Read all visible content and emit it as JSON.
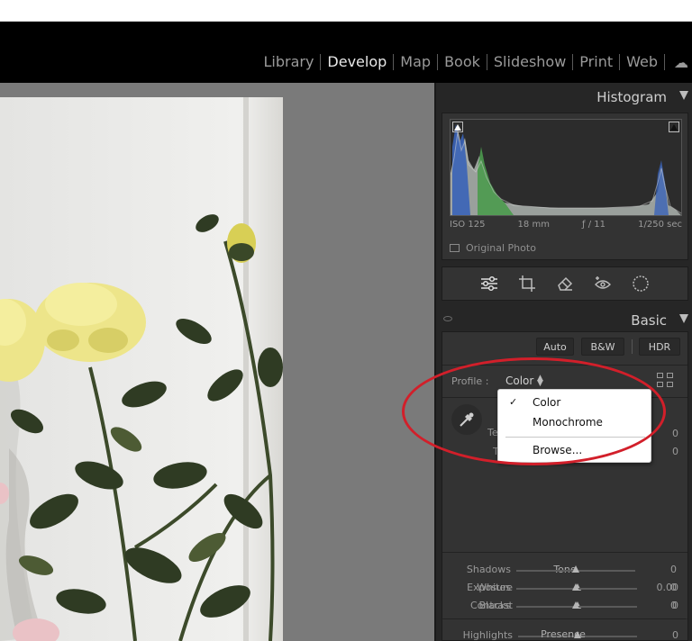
{
  "modules": [
    {
      "label": "Library",
      "active": false
    },
    {
      "label": "Develop",
      "active": true
    },
    {
      "label": "Map",
      "active": false
    },
    {
      "label": "Book",
      "active": false
    },
    {
      "label": "Slideshow",
      "active": false
    },
    {
      "label": "Print",
      "active": false
    },
    {
      "label": "Web",
      "active": false
    }
  ],
  "histogram": {
    "title": "Histogram",
    "iso": "ISO 125",
    "focal": "18 mm",
    "aperture": "ƒ / 11",
    "shutter": "1/250 sec",
    "original_photo_label": "Original Photo",
    "original_photo_checked": false
  },
  "tools": [
    "sliders-icon",
    "crop-icon",
    "eraser-icon",
    "redeye-icon",
    "mask-icon"
  ],
  "basic": {
    "title": "Basic",
    "auto_label": "Auto",
    "bw_label": "B&W",
    "hdr_label": "HDR",
    "profile_label": "Profile :",
    "profile_value": "Color",
    "wb_partial_labels": [
      "Ter",
      "T"
    ],
    "wb_values": [
      "0",
      "0"
    ],
    "tone_title": "Tone",
    "presence_title": "Presence",
    "sliders": [
      {
        "label": "Exposure",
        "value": "0.00",
        "position": 0.5
      },
      {
        "label": "Contrast",
        "value": "0",
        "position": 0.5
      },
      {
        "label": "Highlights",
        "value": "0",
        "position": 0.5
      },
      {
        "label": "Shadows",
        "value": "0",
        "position": 0.5
      },
      {
        "label": "Whites",
        "value": "0",
        "position": 0.5
      },
      {
        "label": "Blacks",
        "value": "0",
        "position": 0.5
      }
    ]
  },
  "profile_menu": {
    "items": [
      {
        "label": "Color",
        "checked": true
      },
      {
        "label": "Monochrome",
        "checked": false
      },
      {
        "label": "Browse...",
        "checked": false
      }
    ]
  },
  "colors": {
    "annotation": "#d21f2a",
    "panel_bg": "#333333",
    "module_active": "#e8e8e8",
    "module_inactive": "#9a9a9a"
  }
}
